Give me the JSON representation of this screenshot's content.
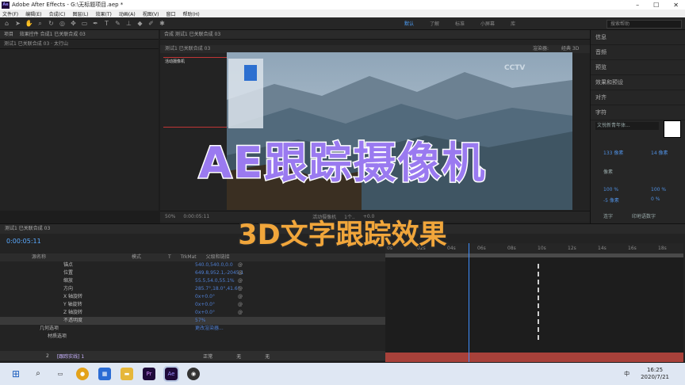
{
  "app": {
    "title": "Adobe After Effects - G:\\无标题项目.aep *"
  },
  "menu": [
    "文件(F)",
    "编辑(E)",
    "合成(C)",
    "图层(L)",
    "效果(T)",
    "动画(A)",
    "视图(V)",
    "窗口",
    "帮助(H)"
  ],
  "workspaces": [
    "默认",
    "了解",
    "标准",
    "小屏幕",
    "库"
  ],
  "search": {
    "placeholder": "搜索帮助"
  },
  "left_panel": {
    "tabs": [
      "项目",
      "效果控件 合成1 已关联合成 03"
    ],
    "sub": "测试1 已关联合成 03 · 太行山"
  },
  "comp_panel": {
    "tab": "合成 测试1 已关联合成 03",
    "breadcrumb": "测试1 已关联合成 03",
    "renderer": "渲染器:",
    "view": "经典 3D",
    "footer": [
      "50%",
      "0:00:05:11",
      "活动摄像机",
      "1个..",
      "+0.0"
    ],
    "overlay_label": "活动摄像机"
  },
  "right_panel": {
    "items": [
      "信息",
      "音频",
      "预览",
      "效果和预设",
      "对齐",
      "字符"
    ],
    "font": "文悦新青年体...",
    "size1": "133 像素",
    "size2": "14 像素",
    "unit": "像素",
    "scale1": "100 %",
    "scale2": "100 %",
    "baseline": "-5 像素",
    "baseline2": "0 %",
    "opt1": "连字",
    "opt2": "印地语数字"
  },
  "timeline": {
    "header": "测试1 已关联合成 03",
    "timecode": "0:00:05:11",
    "columns": [
      "源名称",
      "模式",
      "T",
      "TrkMat",
      "父级和链接"
    ],
    "props": [
      {
        "name": "锚点",
        "value": "540.0,540.0,0.0"
      },
      {
        "name": "位置",
        "value": "649.8,952.1,-2045.1"
      },
      {
        "name": "缩放",
        "value": "55.5,54.0,55.1%"
      },
      {
        "name": "方向",
        "value": "285.7°,18.0°,41.6°"
      },
      {
        "name": "X 轴旋转",
        "value": "0x+0.0°"
      },
      {
        "name": "Y 轴旋转",
        "value": "0x+0.0°"
      },
      {
        "name": "Z 轴旋转",
        "value": "0x+0.0°"
      },
      {
        "name": "不透明度",
        "value": "57%"
      },
      {
        "name": "几何选项",
        "value": "更改渲染器..."
      },
      {
        "name": "材质选项",
        "value": ""
      }
    ],
    "layer": {
      "index": "2",
      "name": "[跟踪实线] 1",
      "mode": "正常",
      "trk": "无",
      "parent": "无"
    },
    "ruler": [
      "0s",
      "02s",
      "04s",
      "06s",
      "08s",
      "10s",
      "12s",
      "14s",
      "16s",
      "18s"
    ]
  },
  "banner": {
    "main": "AE跟踪摄像机",
    "sub": "3D文字跟踪效果"
  },
  "taskbar": {
    "time": "16:25",
    "date": "2020/7/21",
    "ime": "中"
  },
  "colors": {
    "accent_blue": "#4fa3ff",
    "banner_purple": "#9a7af0",
    "banner_orange": "#f1a63b",
    "layer_red": "#a8413a"
  }
}
